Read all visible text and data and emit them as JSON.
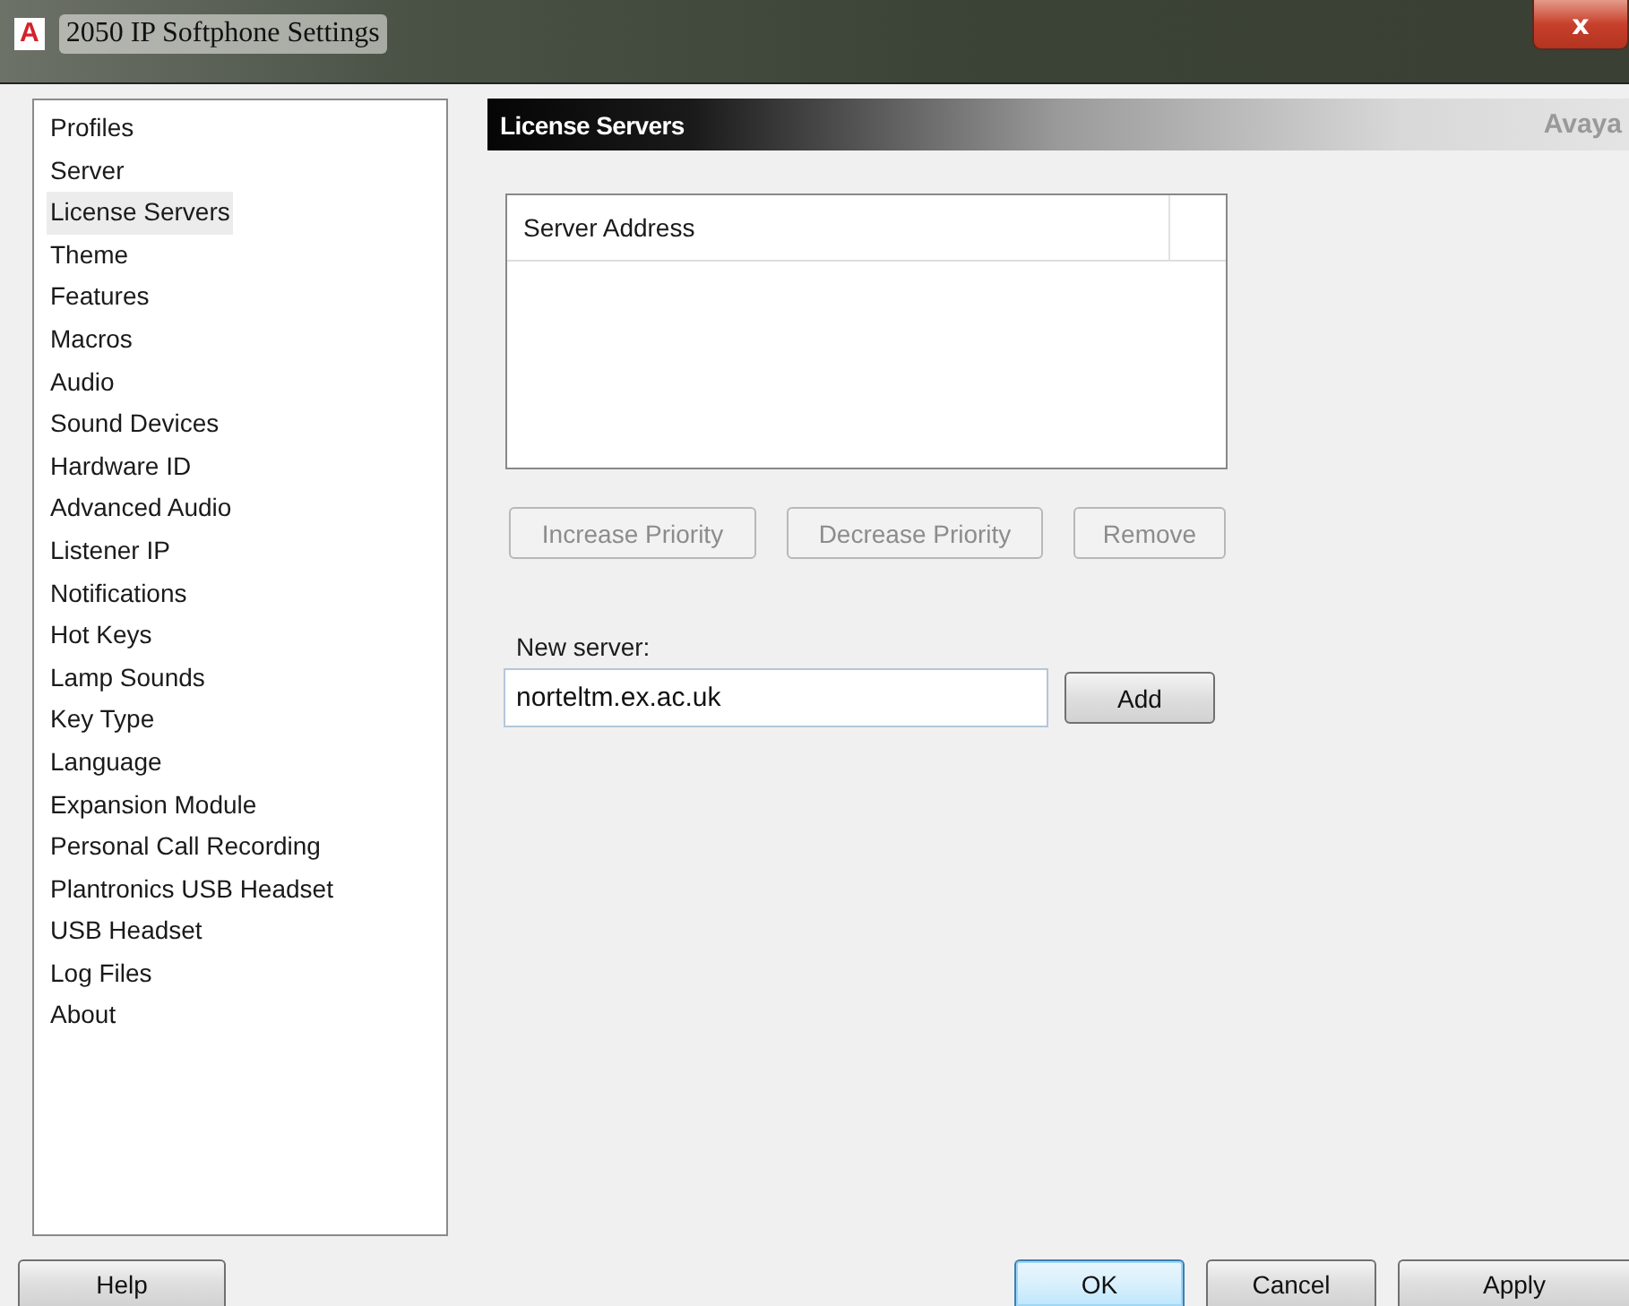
{
  "window": {
    "logo": "A",
    "title": "2050 IP Softphone Settings",
    "close": "x"
  },
  "sidebar": {
    "items": [
      {
        "label": "Profiles",
        "selected": false
      },
      {
        "label": "Server",
        "selected": false
      },
      {
        "label": "License Servers",
        "selected": true
      },
      {
        "label": "Theme",
        "selected": false
      },
      {
        "label": "Features",
        "selected": false
      },
      {
        "label": "Macros",
        "selected": false
      },
      {
        "label": "Audio",
        "selected": false
      },
      {
        "label": "Sound Devices",
        "selected": false
      },
      {
        "label": "Hardware ID",
        "selected": false
      },
      {
        "label": "Advanced Audio",
        "selected": false
      },
      {
        "label": "Listener IP",
        "selected": false
      },
      {
        "label": "Notifications",
        "selected": false
      },
      {
        "label": "Hot Keys",
        "selected": false
      },
      {
        "label": "Lamp Sounds",
        "selected": false
      },
      {
        "label": "Key Type",
        "selected": false
      },
      {
        "label": "Language",
        "selected": false
      },
      {
        "label": "Expansion Module",
        "selected": false
      },
      {
        "label": "Personal Call Recording",
        "selected": false
      },
      {
        "label": "Plantronics USB Headset",
        "selected": false
      },
      {
        "label": "USB Headset",
        "selected": false
      },
      {
        "label": "Log Files",
        "selected": false
      },
      {
        "label": "About",
        "selected": false
      }
    ]
  },
  "panel": {
    "title": "License Servers",
    "brand": "Avaya"
  },
  "table": {
    "columns": [
      "Server Address"
    ]
  },
  "list_buttons": [
    {
      "label": "Increase Priority",
      "disabled": true
    },
    {
      "label": "Decrease Priority",
      "disabled": true
    },
    {
      "label": "Remove",
      "disabled": true
    }
  ],
  "new_server": {
    "label": "New server:",
    "value": "norteltm.ex.ac.uk",
    "button": "Add"
  },
  "help_button": "Help",
  "dialog_buttons": [
    {
      "label": "OK",
      "default": true
    },
    {
      "label": "Cancel",
      "default": false
    },
    {
      "label": "Apply",
      "default": false
    }
  ]
}
